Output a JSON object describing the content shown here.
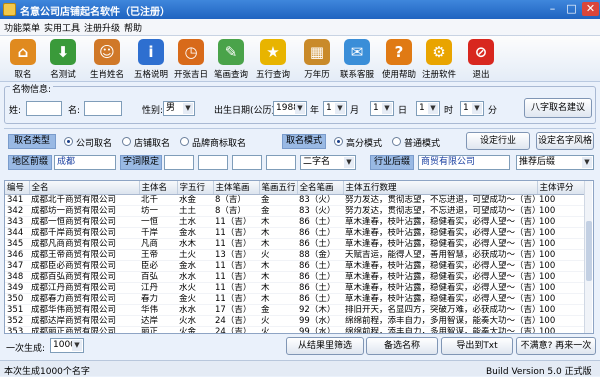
{
  "title": "名意公司店铺起名软件（已注册）",
  "menu": [
    "功能菜单",
    "实用工具",
    "注册升级",
    "帮助"
  ],
  "toolbar": [
    {
      "label": "取名",
      "icon": "home-icon",
      "color": "#e08a1f",
      "glyph": "⌂"
    },
    {
      "label": "名测试",
      "icon": "download-icon",
      "color": "#3a9a3a",
      "glyph": "⬇"
    },
    {
      "label": "生肖姓名",
      "icon": "people-icon",
      "color": "#d07828",
      "glyph": "☺"
    },
    {
      "label": "五格说明",
      "icon": "info-icon",
      "color": "#2e6fd0",
      "glyph": "i"
    },
    {
      "label": "开张吉日",
      "icon": "clock-icon",
      "color": "#d86a1a",
      "glyph": "◷"
    },
    {
      "label": "笔画查询",
      "icon": "document-icon",
      "color": "#4aa34a",
      "glyph": "✎"
    },
    {
      "label": "五行查询",
      "icon": "star-icon",
      "color": "#e8b400",
      "glyph": "★"
    },
    {
      "label": "万年历",
      "icon": "calendar-icon",
      "color": "#c98a2a",
      "glyph": "▦"
    },
    {
      "label": "联系客服",
      "icon": "chat-icon",
      "color": "#3a8ed8",
      "glyph": "✉"
    },
    {
      "label": "使用帮助",
      "icon": "help-icon",
      "color": "#e07a14",
      "glyph": "?"
    },
    {
      "label": "注册软件",
      "icon": "gear-icon",
      "color": "#e9a400",
      "glyph": "⚙"
    },
    {
      "label": "退出",
      "icon": "stop-icon",
      "color": "#d8271f",
      "glyph": "⊘"
    }
  ],
  "info": {
    "legend": "名物信息:",
    "surname_label": "姓:",
    "name_label": "名:",
    "gender_label": "性别:",
    "gender": "男",
    "birth_label": "出生日期(公历):",
    "year": "1988",
    "year_unit": "年",
    "month": "1",
    "month_unit": "月",
    "day": "1",
    "day_unit": "日",
    "hour": "1",
    "hour_unit": "时",
    "minute": "1",
    "minute_unit": "分",
    "suggest_button": "八字取名建议"
  },
  "options": {
    "type_label": "取名类型",
    "radios": [
      "公司取名",
      "店铺取名",
      "品牌商标取名"
    ],
    "mode_label": "取名模式",
    "modes": [
      "高分模式",
      "普通模式"
    ],
    "set_industry_button": "设定行业",
    "set_style_button": "设定名字风格",
    "region_label": "地区前缀",
    "region_value": "成都",
    "char_limit_label": "字词限定",
    "wordcount": "二字名",
    "suffix_label": "行业后缀",
    "suffix_value": "商贸有限公司",
    "suffix_select": "推荐后缀"
  },
  "table": {
    "headers": [
      "编号",
      "全名",
      "主体名",
      "字五行",
      "主体笔画",
      "笔画五行",
      "全名笔画",
      "主体五行数理",
      "主体评分"
    ],
    "rows": [
      [
        "341",
        "成都北千商贸有限公司",
        "北千",
        "水金",
        "8（吉）",
        "金",
        "83（火）",
        "努力发达，贯彻志望，不忘进退，可望成功～（吉）",
        "100"
      ],
      [
        "342",
        "成都坊一商贸有限公司",
        "坊一",
        "土土",
        "8（吉）",
        "金",
        "83（火）",
        "努力发达，贯彻志望，不忘进退，可望成功～（吉）",
        "100"
      ],
      [
        "343",
        "成都一恒商贸有限公司",
        "一恒",
        "土水",
        "11（吉）",
        "木",
        "86（土）",
        "草木逢春，枝叶沾露，稳健着实，必得人望～（吉）",
        "100"
      ],
      [
        "344",
        "成都千岸商贸有限公司",
        "千岸",
        "金水",
        "11（吉）",
        "木",
        "86（土）",
        "草木逢春，枝叶沾露，稳健着实，必得人望～（吉）",
        "100"
      ],
      [
        "345",
        "成都凡商商贸有限公司",
        "凡商",
        "水木",
        "11（吉）",
        "木",
        "86（土）",
        "草木逢春，枝叶沾露，稳健着实，必得人望～（吉）",
        "100"
      ],
      [
        "346",
        "成都王帝商贸有限公司",
        "王帝",
        "土火",
        "13（吉）",
        "火",
        "88（金）",
        "天赋吉运，能得人望，善用智慧，必获成功～（吉）",
        "100"
      ],
      [
        "347",
        "成都臣必商贸有限公司",
        "臣必",
        "金水",
        "11（吉）",
        "木",
        "86（土）",
        "草木逢春，枝叶沾露，稳健着实，必得人望～（吉）",
        "100"
      ],
      [
        "348",
        "成都百弘商贸有限公司",
        "百弘",
        "水水",
        "11（吉）",
        "木",
        "86（土）",
        "草木逢春，枝叶沾露，稳健着实，必得人望～（吉）",
        "100"
      ],
      [
        "349",
        "成都江丹商贸有限公司",
        "江丹",
        "水火",
        "11（吉）",
        "木",
        "86（土）",
        "草木逢春，枝叶沾露，稳健着实，必得人望～（吉）",
        "100"
      ],
      [
        "350",
        "成都春力商贸有限公司",
        "春力",
        "金火",
        "11（吉）",
        "木",
        "86（土）",
        "草木逢春，枝叶沾露，稳健着实，必得人望～（吉）",
        "100"
      ],
      [
        "351",
        "成都华伟商贸有限公司",
        "华伟",
        "水水",
        "17（吉）",
        "金",
        "92（木）",
        "排旧开天，名显四方，突破万难，必获成功～（吉）",
        "100"
      ],
      [
        "352",
        "成都达岸商贸有限公司",
        "达岸",
        "火水",
        "24（吉）",
        "火",
        "99（水）",
        "绵绵前程，添丰自力，多用智谋，能奏大功～（吉）",
        "100"
      ],
      [
        "353",
        "成都丽正商贸有限公司",
        "丽正",
        "火金",
        "24（吉）",
        "火",
        "99（水）",
        "绵绵前程，添丰自力，多用智谋，能奏大功～（吉）",
        "100"
      ]
    ]
  },
  "bottom": {
    "gen_label": "一次生成:",
    "gen_count": "1000",
    "filter_button": "从结果里筛选",
    "backup_button": "备选名称",
    "export_button": "导出到Txt",
    "more_button": "不满意? 再来一次"
  },
  "status": {
    "left": "本次生成1000个名字",
    "right": "Build Version 5.0 正式版"
  }
}
